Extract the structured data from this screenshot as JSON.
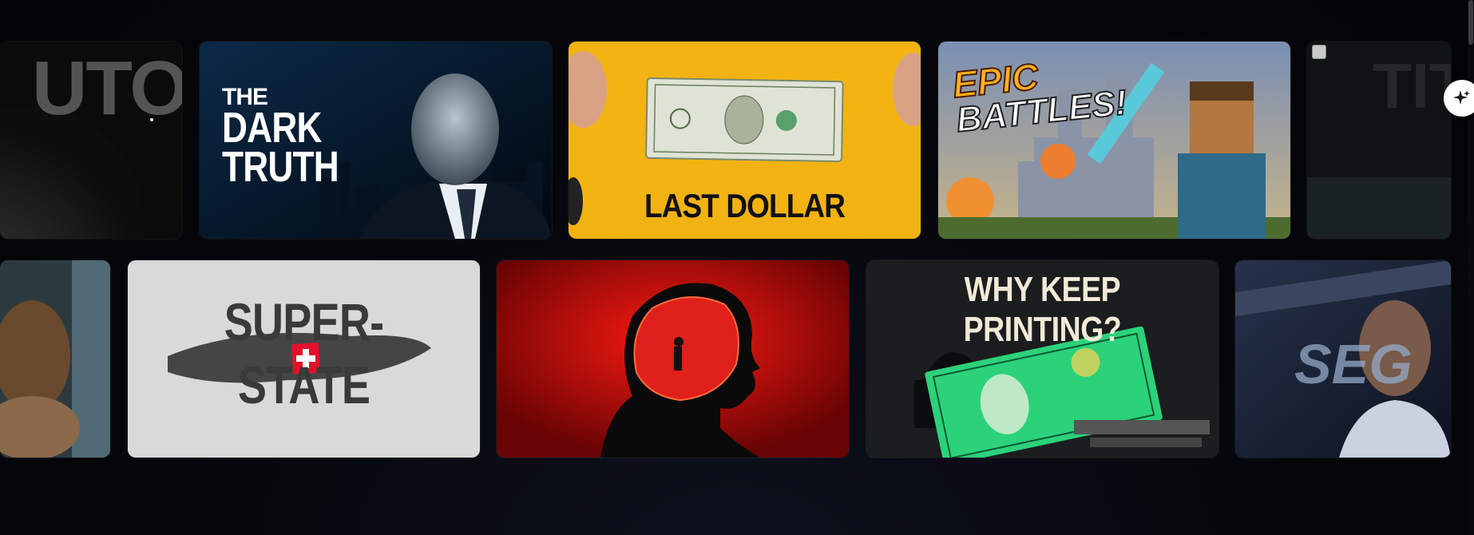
{
  "gallery": {
    "row1": [
      {
        "id": "c1",
        "title": "UTO"
      },
      {
        "id": "c2",
        "title_small": "THE",
        "title_line2": "DARK",
        "title_line3": "TRUTH"
      },
      {
        "id": "c3",
        "title": "LAST DOLLAR"
      },
      {
        "id": "c4",
        "title_line1": "EPIC",
        "title_line2": "BATTLES!"
      },
      {
        "id": "c5",
        "title": "TIT"
      }
    ],
    "row2": [
      {
        "id": "d1",
        "title": ""
      },
      {
        "id": "d2",
        "title_line1": "SUPER-",
        "title_line2": "STATE"
      },
      {
        "id": "d3",
        "title": ""
      },
      {
        "id": "d4",
        "title": "WHY KEEP PRINTING?"
      },
      {
        "id": "d5",
        "title": "SEG"
      }
    ]
  },
  "icons": {
    "ai_button": "sparkle-icon",
    "swiss_flag": "swiss-cross-icon"
  },
  "colors": {
    "background": "#06070b",
    "last_dollar_bg": "#f2b312",
    "red_glow": "#d8140e",
    "money_green": "#2bd27a"
  }
}
